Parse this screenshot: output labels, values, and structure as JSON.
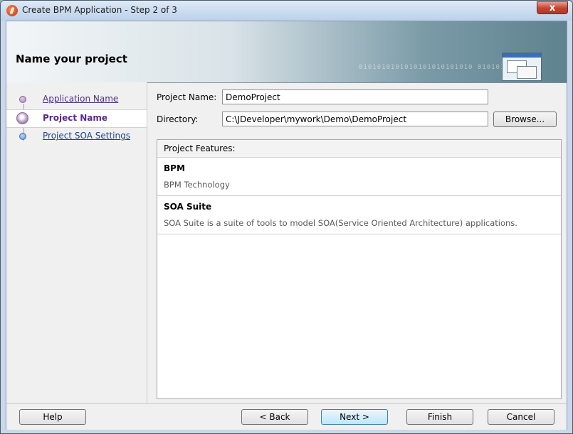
{
  "window": {
    "title": "Create BPM Application - Step 2 of 3",
    "close_label": "x"
  },
  "header": {
    "title": "Name your project",
    "binary_text": "0101010101010101010101010 0101010101010"
  },
  "nav": {
    "items": [
      {
        "label": "Application Name",
        "state": "done"
      },
      {
        "label": "Project Name",
        "state": "active"
      },
      {
        "label": "Project SOA Settings",
        "state": "todo"
      }
    ]
  },
  "form": {
    "project_name_label": "Project Name:",
    "project_name_value": "DemoProject",
    "directory_label": "Directory:",
    "directory_value": "C:\\JDeveloper\\mywork\\Demo\\DemoProject",
    "browse_label": "Browse..."
  },
  "features": {
    "header": "Project Features:",
    "items": [
      {
        "name": "BPM",
        "description": "BPM Technology"
      },
      {
        "name": "SOA Suite",
        "description": "SOA Suite is a suite of tools to model SOA(Service Oriented Architecture) applications."
      }
    ]
  },
  "buttons": {
    "help": "Help",
    "back": "< Back",
    "next": "Next >",
    "finish": "Finish",
    "cancel": "Cancel"
  },
  "colors": {
    "visited_link": "#4b2f8a",
    "link": "#1c3f9a",
    "close_red": "#c5412f"
  }
}
